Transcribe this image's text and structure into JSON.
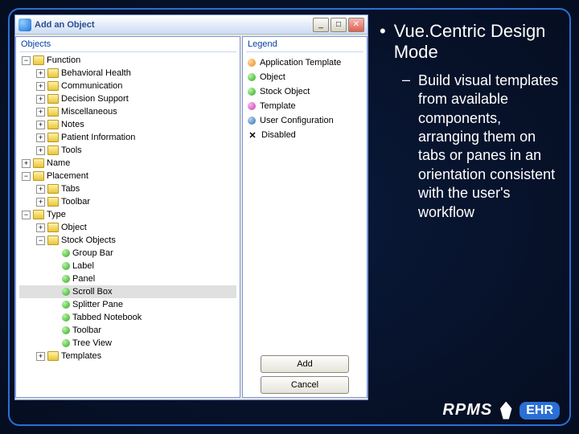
{
  "dialog": {
    "title": "Add an Object",
    "objects_header": "Objects",
    "legend_header": "Legend",
    "buttons": {
      "add": "Add",
      "cancel": "Cancel"
    }
  },
  "tree": [
    {
      "indent": 0,
      "exp": "-",
      "icon": "folder",
      "label": "Function"
    },
    {
      "indent": 1,
      "exp": "+",
      "icon": "folder",
      "label": "Behavioral Health"
    },
    {
      "indent": 1,
      "exp": "+",
      "icon": "folder",
      "label": "Communication"
    },
    {
      "indent": 1,
      "exp": "+",
      "icon": "folder",
      "label": "Decision Support"
    },
    {
      "indent": 1,
      "exp": "+",
      "icon": "folder",
      "label": "Miscellaneous"
    },
    {
      "indent": 1,
      "exp": "+",
      "icon": "folder",
      "label": "Notes"
    },
    {
      "indent": 1,
      "exp": "+",
      "icon": "folder",
      "label": "Patient Information"
    },
    {
      "indent": 1,
      "exp": "+",
      "icon": "folder",
      "label": "Tools"
    },
    {
      "indent": 0,
      "exp": "+",
      "icon": "folder",
      "label": "Name"
    },
    {
      "indent": 0,
      "exp": "-",
      "icon": "folder",
      "label": "Placement"
    },
    {
      "indent": 1,
      "exp": "+",
      "icon": "folder",
      "label": "Tabs"
    },
    {
      "indent": 1,
      "exp": "+",
      "icon": "folder",
      "label": "Toolbar"
    },
    {
      "indent": 0,
      "exp": "-",
      "icon": "folder",
      "label": "Type"
    },
    {
      "indent": 1,
      "exp": "+",
      "icon": "folder",
      "label": "Object"
    },
    {
      "indent": 1,
      "exp": "-",
      "icon": "folder",
      "label": "Stock Objects"
    },
    {
      "indent": 2,
      "exp": "",
      "icon": "green",
      "label": "Group Bar"
    },
    {
      "indent": 2,
      "exp": "",
      "icon": "green",
      "label": "Label"
    },
    {
      "indent": 2,
      "exp": "",
      "icon": "green",
      "label": "Panel"
    },
    {
      "indent": 2,
      "exp": "",
      "icon": "green",
      "label": "Scroll Box",
      "selected": true
    },
    {
      "indent": 2,
      "exp": "",
      "icon": "green",
      "label": "Splitter Pane"
    },
    {
      "indent": 2,
      "exp": "",
      "icon": "green",
      "label": "Tabbed Notebook"
    },
    {
      "indent": 2,
      "exp": "",
      "icon": "green",
      "label": "Toolbar"
    },
    {
      "indent": 2,
      "exp": "",
      "icon": "green",
      "label": "Tree View"
    },
    {
      "indent": 1,
      "exp": "+",
      "icon": "folder",
      "label": "Templates"
    }
  ],
  "legend": [
    {
      "icon": "orange",
      "label": "Application Template"
    },
    {
      "icon": "green",
      "label": "Object"
    },
    {
      "icon": "green",
      "label": "Stock Object"
    },
    {
      "icon": "mag",
      "label": "Template"
    },
    {
      "icon": "blue",
      "label": "User Configuration"
    },
    {
      "icon": "x",
      "label": "Disabled"
    }
  ],
  "slide": {
    "title": "Vue.Centric Design Mode",
    "body": "Build visual templates from available components, arranging them on tabs or panes in an orientation consistent with the user's workflow"
  },
  "logo": {
    "rpms": "RPMS",
    "ehr": "EHR"
  }
}
